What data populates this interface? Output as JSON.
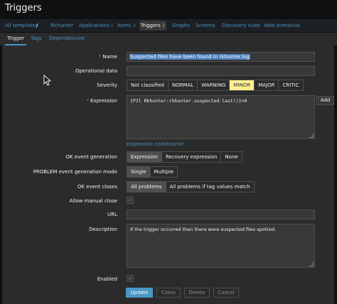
{
  "page": {
    "title": "Triggers"
  },
  "nav": {
    "all_templates": "All templates",
    "separator": "/",
    "items": [
      {
        "label": "Rkhunter",
        "count": ""
      },
      {
        "label": "Applications",
        "count": "1"
      },
      {
        "label": "Items",
        "count": "3"
      },
      {
        "label": "Triggers",
        "count": "3"
      },
      {
        "label": "Graphs",
        "count": ""
      },
      {
        "label": "Screens",
        "count": ""
      },
      {
        "label": "Discovery rules",
        "count": ""
      },
      {
        "label": "Web scenarios",
        "count": ""
      }
    ]
  },
  "tabs": [
    "Trigger",
    "Tags",
    "Dependencies"
  ],
  "form": {
    "name": {
      "label": "Name",
      "required": "*",
      "value": "Suspected files have been found in rkhunter.log"
    },
    "operational_data": {
      "label": "Operational data",
      "value": ""
    },
    "severity": {
      "label": "Severity",
      "options": [
        "Not classified",
        "NORMAL",
        "WARNING",
        "MINOR",
        "MAJOR",
        "CRITIC"
      ],
      "selected": "MINOR"
    },
    "expression": {
      "label": "Expression",
      "required": "*",
      "value": "{P2l Rkhunter:rkhunter.suspected.last()}>0",
      "add_label": "Add",
      "constructor_link": "Expression constructor"
    },
    "ok_event_generation": {
      "label": "OK event generation",
      "options": [
        "Expression",
        "Recovery expression",
        "None"
      ],
      "selected": "Expression"
    },
    "problem_mode": {
      "label": "PROBLEM event generation mode",
      "options": [
        "Single",
        "Multiple"
      ],
      "selected": "Single"
    },
    "ok_event_closes": {
      "label": "OK event closes",
      "options": [
        "All problems",
        "All problems if tag values match"
      ],
      "selected": "All problems"
    },
    "allow_manual_close": {
      "label": "Allow manual close",
      "checked": true,
      "mark": "✓"
    },
    "url": {
      "label": "URL",
      "value": ""
    },
    "description": {
      "label": "Description",
      "value": "If the trigger occurred than there were suspected files spotted."
    },
    "enabled": {
      "label": "Enabled",
      "checked": true,
      "mark": "✓"
    }
  },
  "buttons": {
    "update": "Update",
    "clone": "Clone",
    "delete": "Delete",
    "cancel": "Cancel"
  },
  "colors": {
    "accent": "#4796c4",
    "minor": "#ffef91",
    "background": "#2b2b2b",
    "required": "#e45959"
  }
}
